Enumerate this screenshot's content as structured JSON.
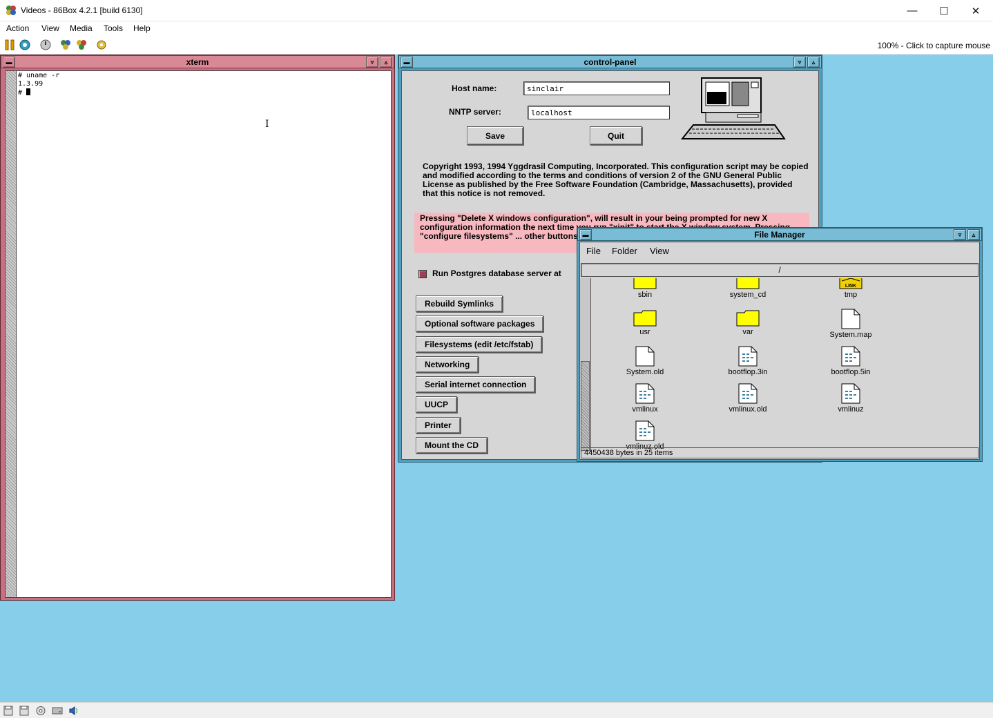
{
  "host": {
    "title": "Videos - 86Box 4.2.1 [build 6130]",
    "menu": [
      "Action",
      "View",
      "Media",
      "Tools",
      "Help"
    ],
    "capture_hint": "100% - Click to capture mouse",
    "controls": {
      "minimize": "—",
      "maximize": "☐",
      "close": "✕"
    }
  },
  "xterm": {
    "title": "xterm",
    "lines": [
      "# uname -r",
      "1.3.99",
      "# "
    ]
  },
  "control_panel": {
    "title": "control-panel",
    "host_name_label": "Host name:",
    "host_name_value": "sinclair",
    "nntp_label": "NNTP server:",
    "nntp_value": "localhost",
    "save": "Save",
    "quit": "Quit",
    "copyright": "Copyright 1993, 1994 Yggdrasil Computing, Incorporated.  This configuration script may be copied and modified according to the terms and conditions of version 2 of the GNU General Public License as published by the Free Software Foundation (Cambridge, Massachusetts), provided that this notice is not removed.",
    "warning": "Pressing \"Delete X windows configuration\", will result in your being prompted for new X configuration information the next time you run \"xinit\" to start the X window system.  Pressing \"configure filesystems\" ... other buttons invoke more interesting",
    "checkbox_label": "Run Postgres database server at",
    "buttons": [
      "Rebuild Symlinks",
      "Optional software packages",
      "Filesystems (edit /etc/fstab)",
      "Networking",
      "Serial internet connection",
      "UUCP",
      "Printer",
      "Mount the CD"
    ]
  },
  "file_manager": {
    "title": "File Manager",
    "menu": [
      "File",
      "Folder",
      "View"
    ],
    "path": "/",
    "items": [
      {
        "name": "sbin",
        "type": "folder"
      },
      {
        "name": "system_cd",
        "type": "folder"
      },
      {
        "name": "tmp",
        "type": "link"
      },
      {
        "name": "usr",
        "type": "folder"
      },
      {
        "name": "var",
        "type": "folder"
      },
      {
        "name": "System.map",
        "type": "file"
      },
      {
        "name": "System.old",
        "type": "file"
      },
      {
        "name": "bootflop.3in",
        "type": "binary"
      },
      {
        "name": "bootflop.5in",
        "type": "binary"
      },
      {
        "name": "vmlinux",
        "type": "binary"
      },
      {
        "name": "vmlinux.old",
        "type": "binary"
      },
      {
        "name": "vmlinuz",
        "type": "binary"
      },
      {
        "name": "vmlinuz.old",
        "type": "binary"
      }
    ],
    "link_badge": "LINK",
    "status": "4450438 bytes in 25 items"
  },
  "colors": {
    "desktop": "#87ceeb",
    "xterm_frame": "#c86f80",
    "motif_frame": "#4f9fbd",
    "folder": "#ffff00",
    "warning_bg": "#f7b8c0"
  }
}
